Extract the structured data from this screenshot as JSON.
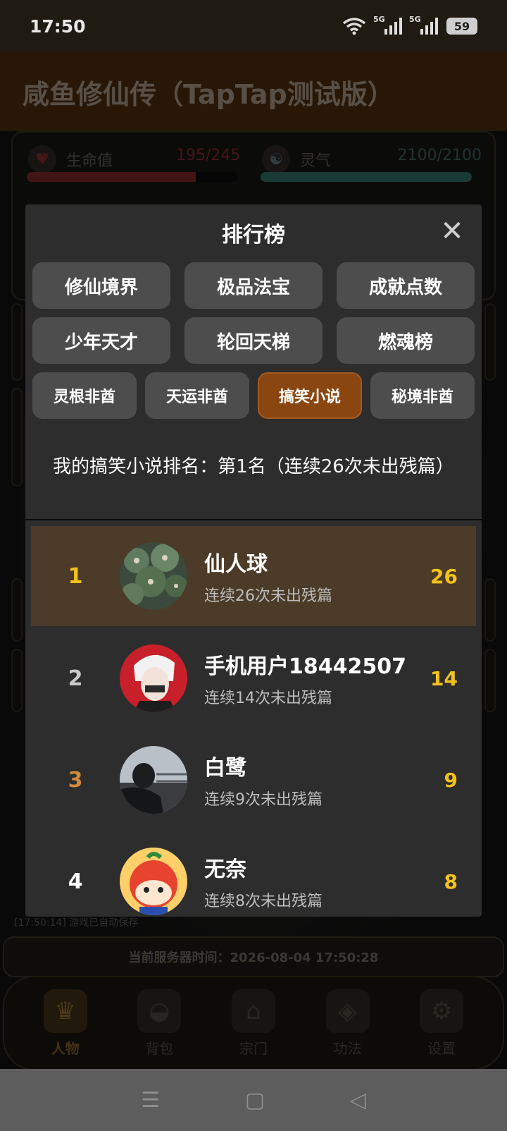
{
  "status_bar": {
    "time": "17:50",
    "net1": "5G",
    "net2": "5G",
    "battery": "59"
  },
  "app": {
    "title": "咸鱼修仙传（TapTap测试版）"
  },
  "stats": {
    "hp": {
      "label": "生命值",
      "value": "195/245",
      "fill_fraction": 0.8
    },
    "qi": {
      "label": "灵气",
      "value": "2100/2100",
      "fill_fraction": 1.0
    }
  },
  "log": {
    "text": "[17:50:14] 游戏已自动保存"
  },
  "server_time": {
    "text": "当前服务器时间：2026-08-04 17:50:28"
  },
  "bottom_nav": [
    {
      "label": "人物",
      "icon": "character-icon",
      "active": true
    },
    {
      "label": "背包",
      "icon": "bag-icon",
      "active": false
    },
    {
      "label": "宗门",
      "icon": "sect-icon",
      "active": false
    },
    {
      "label": "功法",
      "icon": "skill-scroll-icon",
      "active": false
    },
    {
      "label": "设置",
      "icon": "gear-icon",
      "active": false
    }
  ],
  "leaderboard": {
    "title": "排行榜",
    "tabs_row1": [
      "修仙境界",
      "极品法宝",
      "成就点数"
    ],
    "tabs_row2": [
      "少年天才",
      "轮回天梯",
      "燃魂榜"
    ],
    "tabs_row3": [
      "灵根非酋",
      "天运非酋",
      "搞笑小说",
      "秘境非酋"
    ],
    "active_tab": "搞笑小说",
    "my_rank": "我的搞笑小说排名：第1名（连续26次未出残篇）",
    "entries": [
      {
        "rank": "1",
        "name": "仙人球",
        "detail": "连续26次未出残篇",
        "score": "26",
        "rank_color": "#f2c21b"
      },
      {
        "rank": "2",
        "name": "手机用户18442507",
        "detail": "连续14次未出残篇",
        "score": "14",
        "rank_color": "#c9c9c9"
      },
      {
        "rank": "3",
        "name": "白鹭",
        "detail": "连续9次未出残篇",
        "score": "9",
        "rank_color": "#d08a3c"
      },
      {
        "rank": "4",
        "name": "无奈",
        "detail": "连续8次未出残篇",
        "score": "8",
        "rank_color": "#ffffff"
      }
    ]
  }
}
